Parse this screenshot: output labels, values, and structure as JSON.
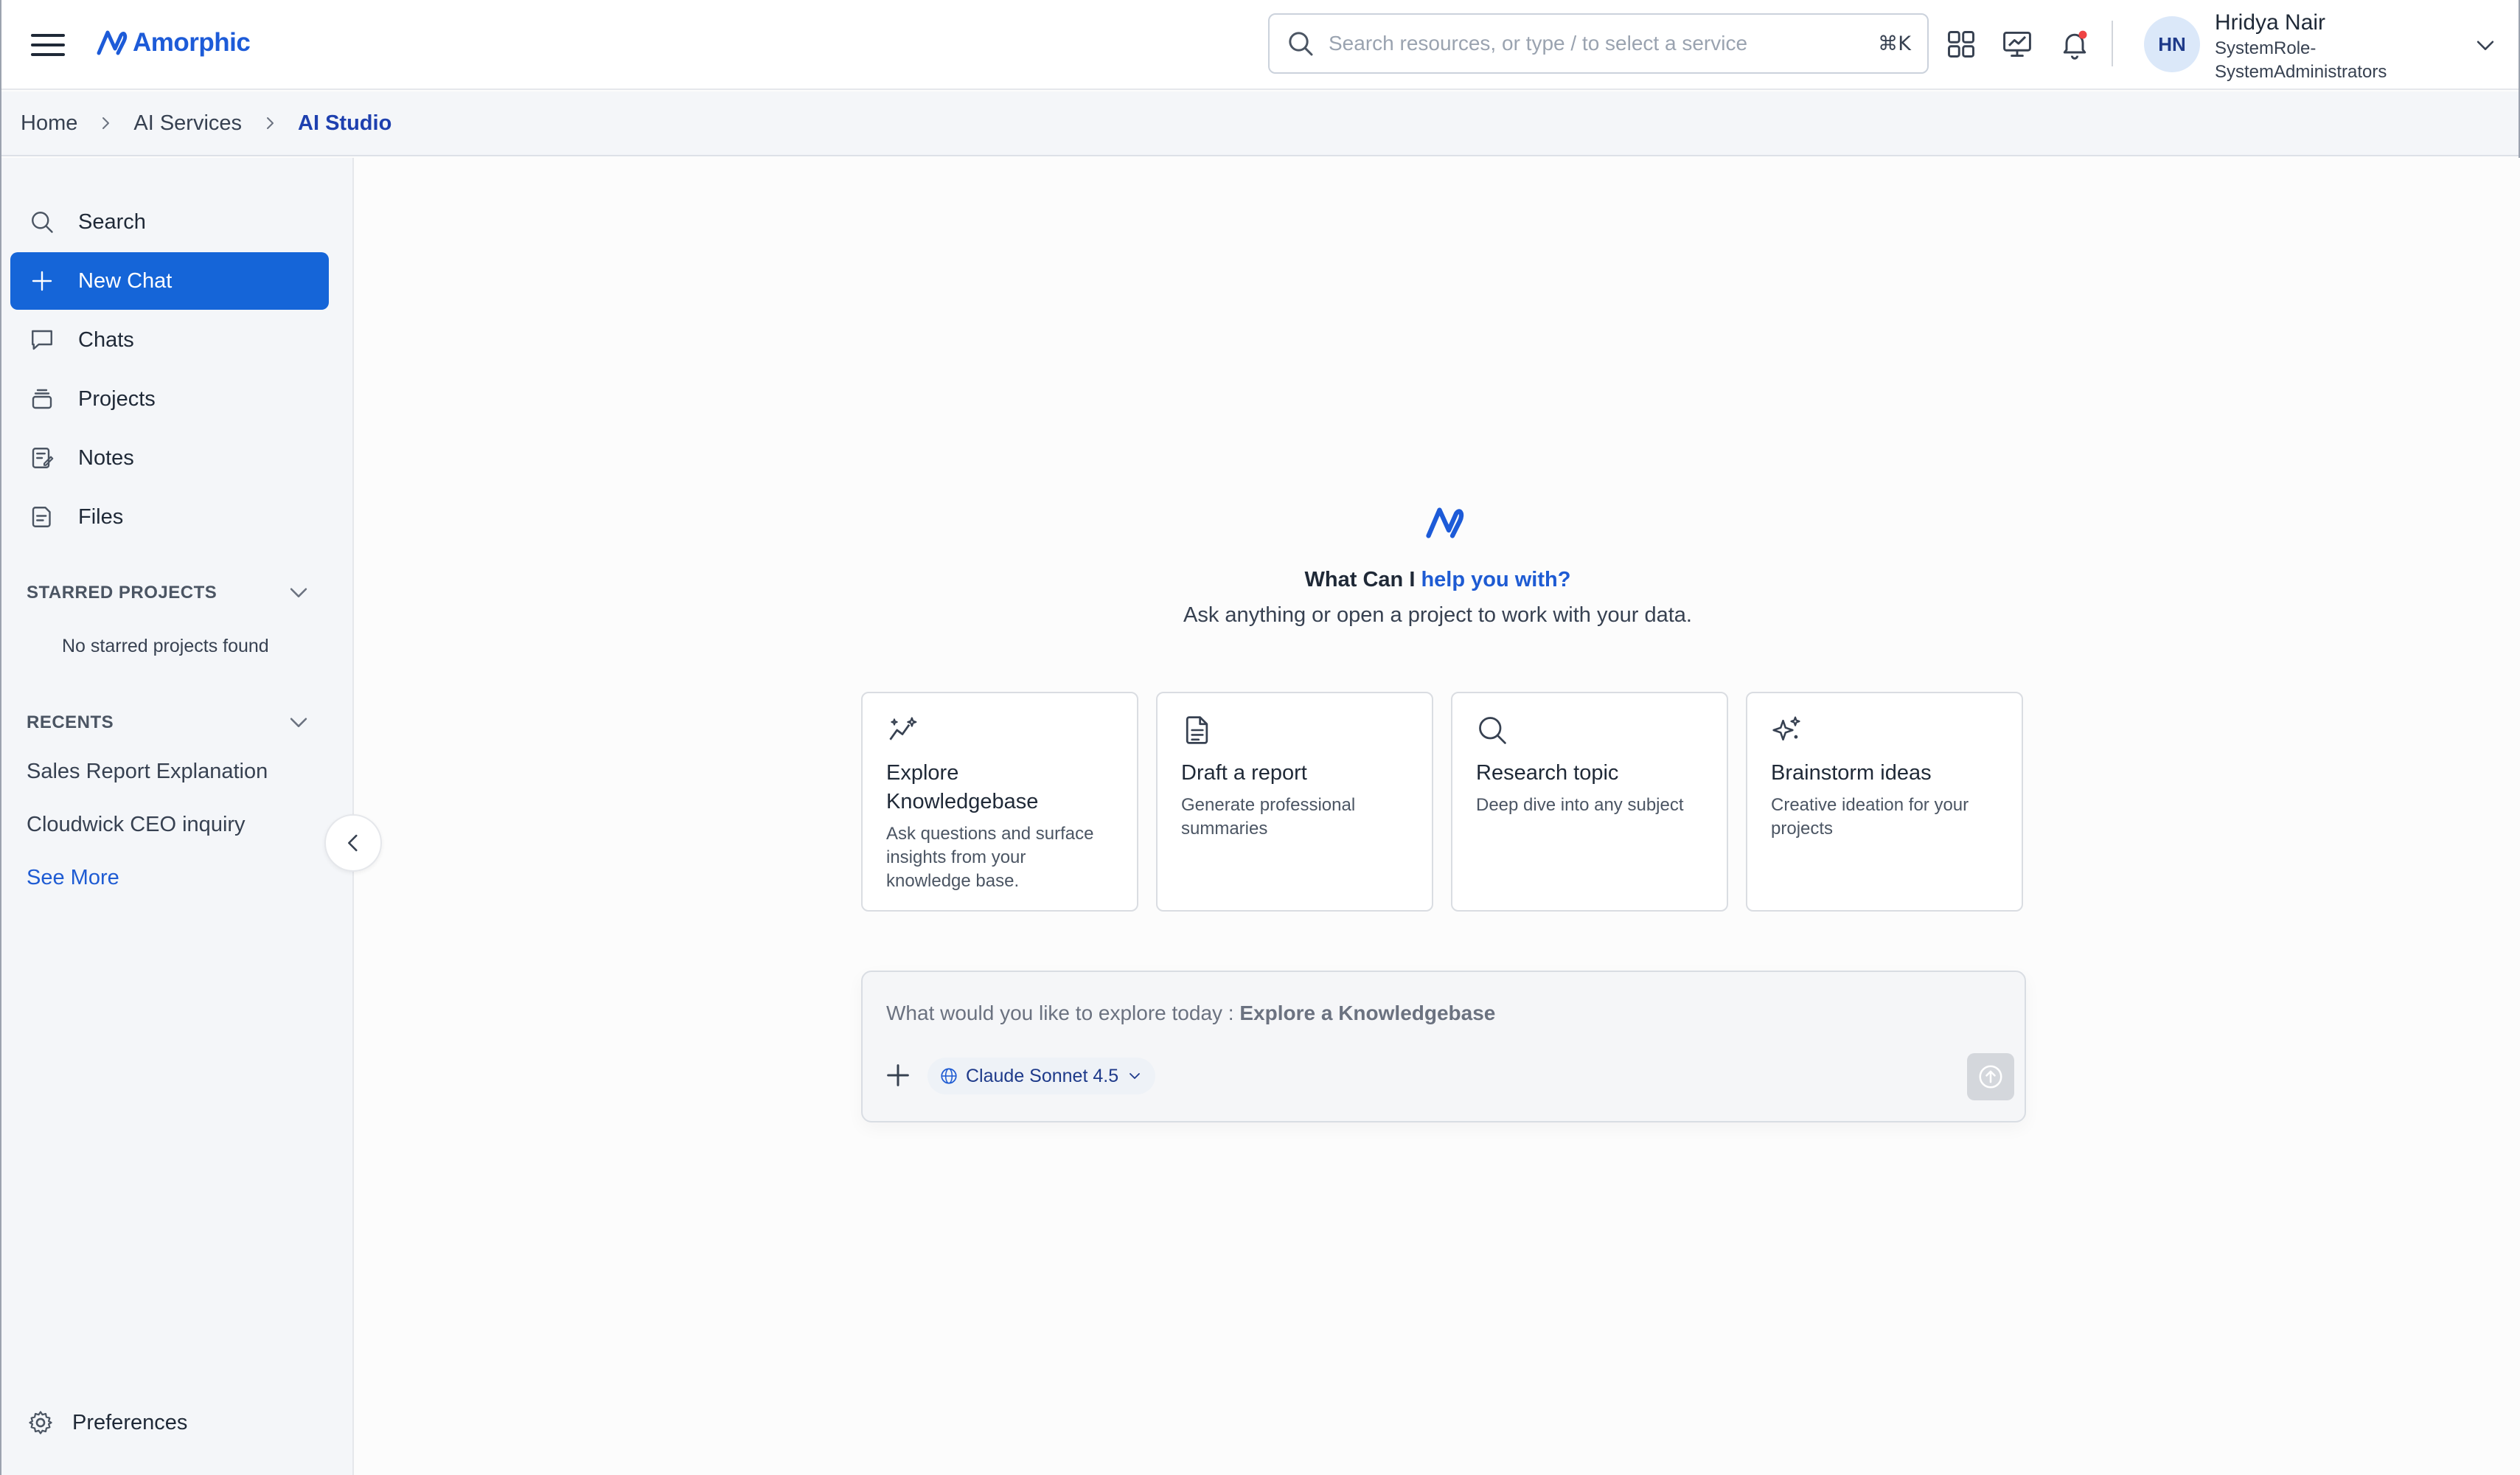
{
  "brand": {
    "name": "Amorphic",
    "color": "#1d5bd8"
  },
  "header": {
    "search_placeholder": "Search resources, or type / to select a service",
    "search_shortcut": "⌘K",
    "icons": [
      "apps-grid-icon",
      "analytics-monitor-icon",
      "notification-bell-icon"
    ],
    "user": {
      "initials": "HN",
      "name": "Hridya Nair",
      "role_line1": "SystemRole-",
      "role_line2": "SystemAdministrators"
    }
  },
  "breadcrumb": {
    "items": [
      "Home",
      "AI Services",
      "AI Studio"
    ]
  },
  "sidebar": {
    "nav": [
      {
        "label": "Search",
        "icon": "search-icon"
      },
      {
        "label": "New Chat",
        "icon": "plus-icon",
        "active": true
      },
      {
        "label": "Chats",
        "icon": "chat-bubble-icon"
      },
      {
        "label": "Projects",
        "icon": "projects-stack-icon"
      },
      {
        "label": "Notes",
        "icon": "notes-icon"
      },
      {
        "label": "Files",
        "icon": "files-icon"
      }
    ],
    "starred": {
      "title": "STARRED PROJECTS",
      "empty": "No starred projects found"
    },
    "recents": {
      "title": "RECENTS",
      "items": [
        "Sales Report Explanation",
        "Cloudwick CEO inquiry"
      ],
      "see_more": "See More"
    },
    "preferences": "Preferences"
  },
  "main": {
    "hero": {
      "title_prefix": "What Can I",
      "title_highlight": "help you with?",
      "subtitle": "Ask anything or open a project to work with your data."
    },
    "cards": [
      {
        "title": "Explore Knowledgebase",
        "desc": "Ask questions and surface insights from your knowledge base.",
        "icon": "sparkle-chart-icon"
      },
      {
        "title": "Draft a report",
        "desc": "Generate professional summaries",
        "icon": "document-icon"
      },
      {
        "title": "Research topic",
        "desc": "Deep dive into any subject",
        "icon": "search-icon"
      },
      {
        "title": "Brainstorm ideas",
        "desc": "Creative ideation for your projects",
        "icon": "sparkles-icon"
      }
    ],
    "composer": {
      "placeholder_prefix": "What would you like to explore today :",
      "placeholder_mode": "Explore a Knowledgebase",
      "model": "Claude Sonnet 4.5"
    }
  },
  "colors": {
    "accent": "#1565d8",
    "link": "#1e5bd3"
  }
}
